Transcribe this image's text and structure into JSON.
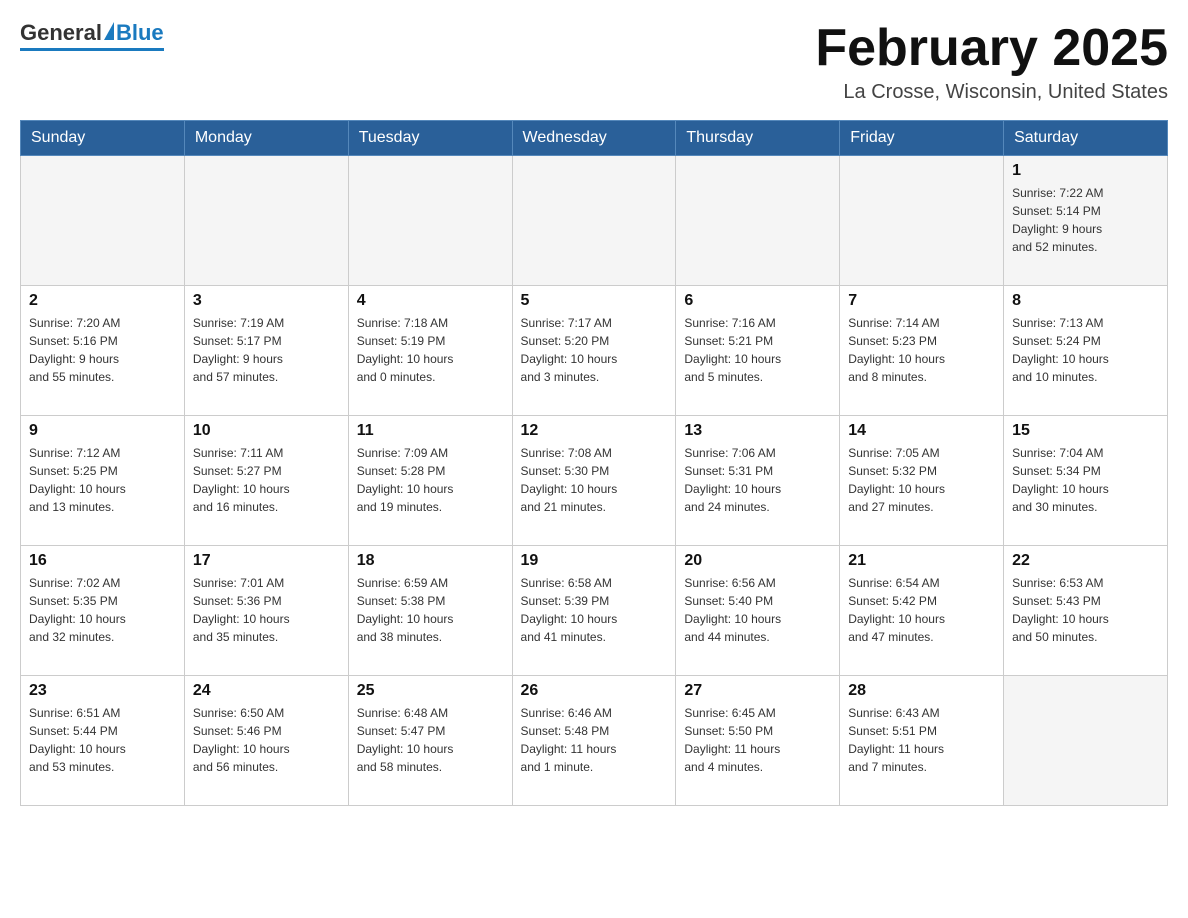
{
  "header": {
    "logo_general": "General",
    "logo_blue": "Blue",
    "month_title": "February 2025",
    "location": "La Crosse, Wisconsin, United States"
  },
  "days_of_week": [
    "Sunday",
    "Monday",
    "Tuesday",
    "Wednesday",
    "Thursday",
    "Friday",
    "Saturday"
  ],
  "weeks": [
    [
      {
        "day": "",
        "info": ""
      },
      {
        "day": "",
        "info": ""
      },
      {
        "day": "",
        "info": ""
      },
      {
        "day": "",
        "info": ""
      },
      {
        "day": "",
        "info": ""
      },
      {
        "day": "",
        "info": ""
      },
      {
        "day": "1",
        "info": "Sunrise: 7:22 AM\nSunset: 5:14 PM\nDaylight: 9 hours\nand 52 minutes."
      }
    ],
    [
      {
        "day": "2",
        "info": "Sunrise: 7:20 AM\nSunset: 5:16 PM\nDaylight: 9 hours\nand 55 minutes."
      },
      {
        "day": "3",
        "info": "Sunrise: 7:19 AM\nSunset: 5:17 PM\nDaylight: 9 hours\nand 57 minutes."
      },
      {
        "day": "4",
        "info": "Sunrise: 7:18 AM\nSunset: 5:19 PM\nDaylight: 10 hours\nand 0 minutes."
      },
      {
        "day": "5",
        "info": "Sunrise: 7:17 AM\nSunset: 5:20 PM\nDaylight: 10 hours\nand 3 minutes."
      },
      {
        "day": "6",
        "info": "Sunrise: 7:16 AM\nSunset: 5:21 PM\nDaylight: 10 hours\nand 5 minutes."
      },
      {
        "day": "7",
        "info": "Sunrise: 7:14 AM\nSunset: 5:23 PM\nDaylight: 10 hours\nand 8 minutes."
      },
      {
        "day": "8",
        "info": "Sunrise: 7:13 AM\nSunset: 5:24 PM\nDaylight: 10 hours\nand 10 minutes."
      }
    ],
    [
      {
        "day": "9",
        "info": "Sunrise: 7:12 AM\nSunset: 5:25 PM\nDaylight: 10 hours\nand 13 minutes."
      },
      {
        "day": "10",
        "info": "Sunrise: 7:11 AM\nSunset: 5:27 PM\nDaylight: 10 hours\nand 16 minutes."
      },
      {
        "day": "11",
        "info": "Sunrise: 7:09 AM\nSunset: 5:28 PM\nDaylight: 10 hours\nand 19 minutes."
      },
      {
        "day": "12",
        "info": "Sunrise: 7:08 AM\nSunset: 5:30 PM\nDaylight: 10 hours\nand 21 minutes."
      },
      {
        "day": "13",
        "info": "Sunrise: 7:06 AM\nSunset: 5:31 PM\nDaylight: 10 hours\nand 24 minutes."
      },
      {
        "day": "14",
        "info": "Sunrise: 7:05 AM\nSunset: 5:32 PM\nDaylight: 10 hours\nand 27 minutes."
      },
      {
        "day": "15",
        "info": "Sunrise: 7:04 AM\nSunset: 5:34 PM\nDaylight: 10 hours\nand 30 minutes."
      }
    ],
    [
      {
        "day": "16",
        "info": "Sunrise: 7:02 AM\nSunset: 5:35 PM\nDaylight: 10 hours\nand 32 minutes."
      },
      {
        "day": "17",
        "info": "Sunrise: 7:01 AM\nSunset: 5:36 PM\nDaylight: 10 hours\nand 35 minutes."
      },
      {
        "day": "18",
        "info": "Sunrise: 6:59 AM\nSunset: 5:38 PM\nDaylight: 10 hours\nand 38 minutes."
      },
      {
        "day": "19",
        "info": "Sunrise: 6:58 AM\nSunset: 5:39 PM\nDaylight: 10 hours\nand 41 minutes."
      },
      {
        "day": "20",
        "info": "Sunrise: 6:56 AM\nSunset: 5:40 PM\nDaylight: 10 hours\nand 44 minutes."
      },
      {
        "day": "21",
        "info": "Sunrise: 6:54 AM\nSunset: 5:42 PM\nDaylight: 10 hours\nand 47 minutes."
      },
      {
        "day": "22",
        "info": "Sunrise: 6:53 AM\nSunset: 5:43 PM\nDaylight: 10 hours\nand 50 minutes."
      }
    ],
    [
      {
        "day": "23",
        "info": "Sunrise: 6:51 AM\nSunset: 5:44 PM\nDaylight: 10 hours\nand 53 minutes."
      },
      {
        "day": "24",
        "info": "Sunrise: 6:50 AM\nSunset: 5:46 PM\nDaylight: 10 hours\nand 56 minutes."
      },
      {
        "day": "25",
        "info": "Sunrise: 6:48 AM\nSunset: 5:47 PM\nDaylight: 10 hours\nand 58 minutes."
      },
      {
        "day": "26",
        "info": "Sunrise: 6:46 AM\nSunset: 5:48 PM\nDaylight: 11 hours\nand 1 minute."
      },
      {
        "day": "27",
        "info": "Sunrise: 6:45 AM\nSunset: 5:50 PM\nDaylight: 11 hours\nand 4 minutes."
      },
      {
        "day": "28",
        "info": "Sunrise: 6:43 AM\nSunset: 5:51 PM\nDaylight: 11 hours\nand 7 minutes."
      },
      {
        "day": "",
        "info": ""
      }
    ]
  ]
}
